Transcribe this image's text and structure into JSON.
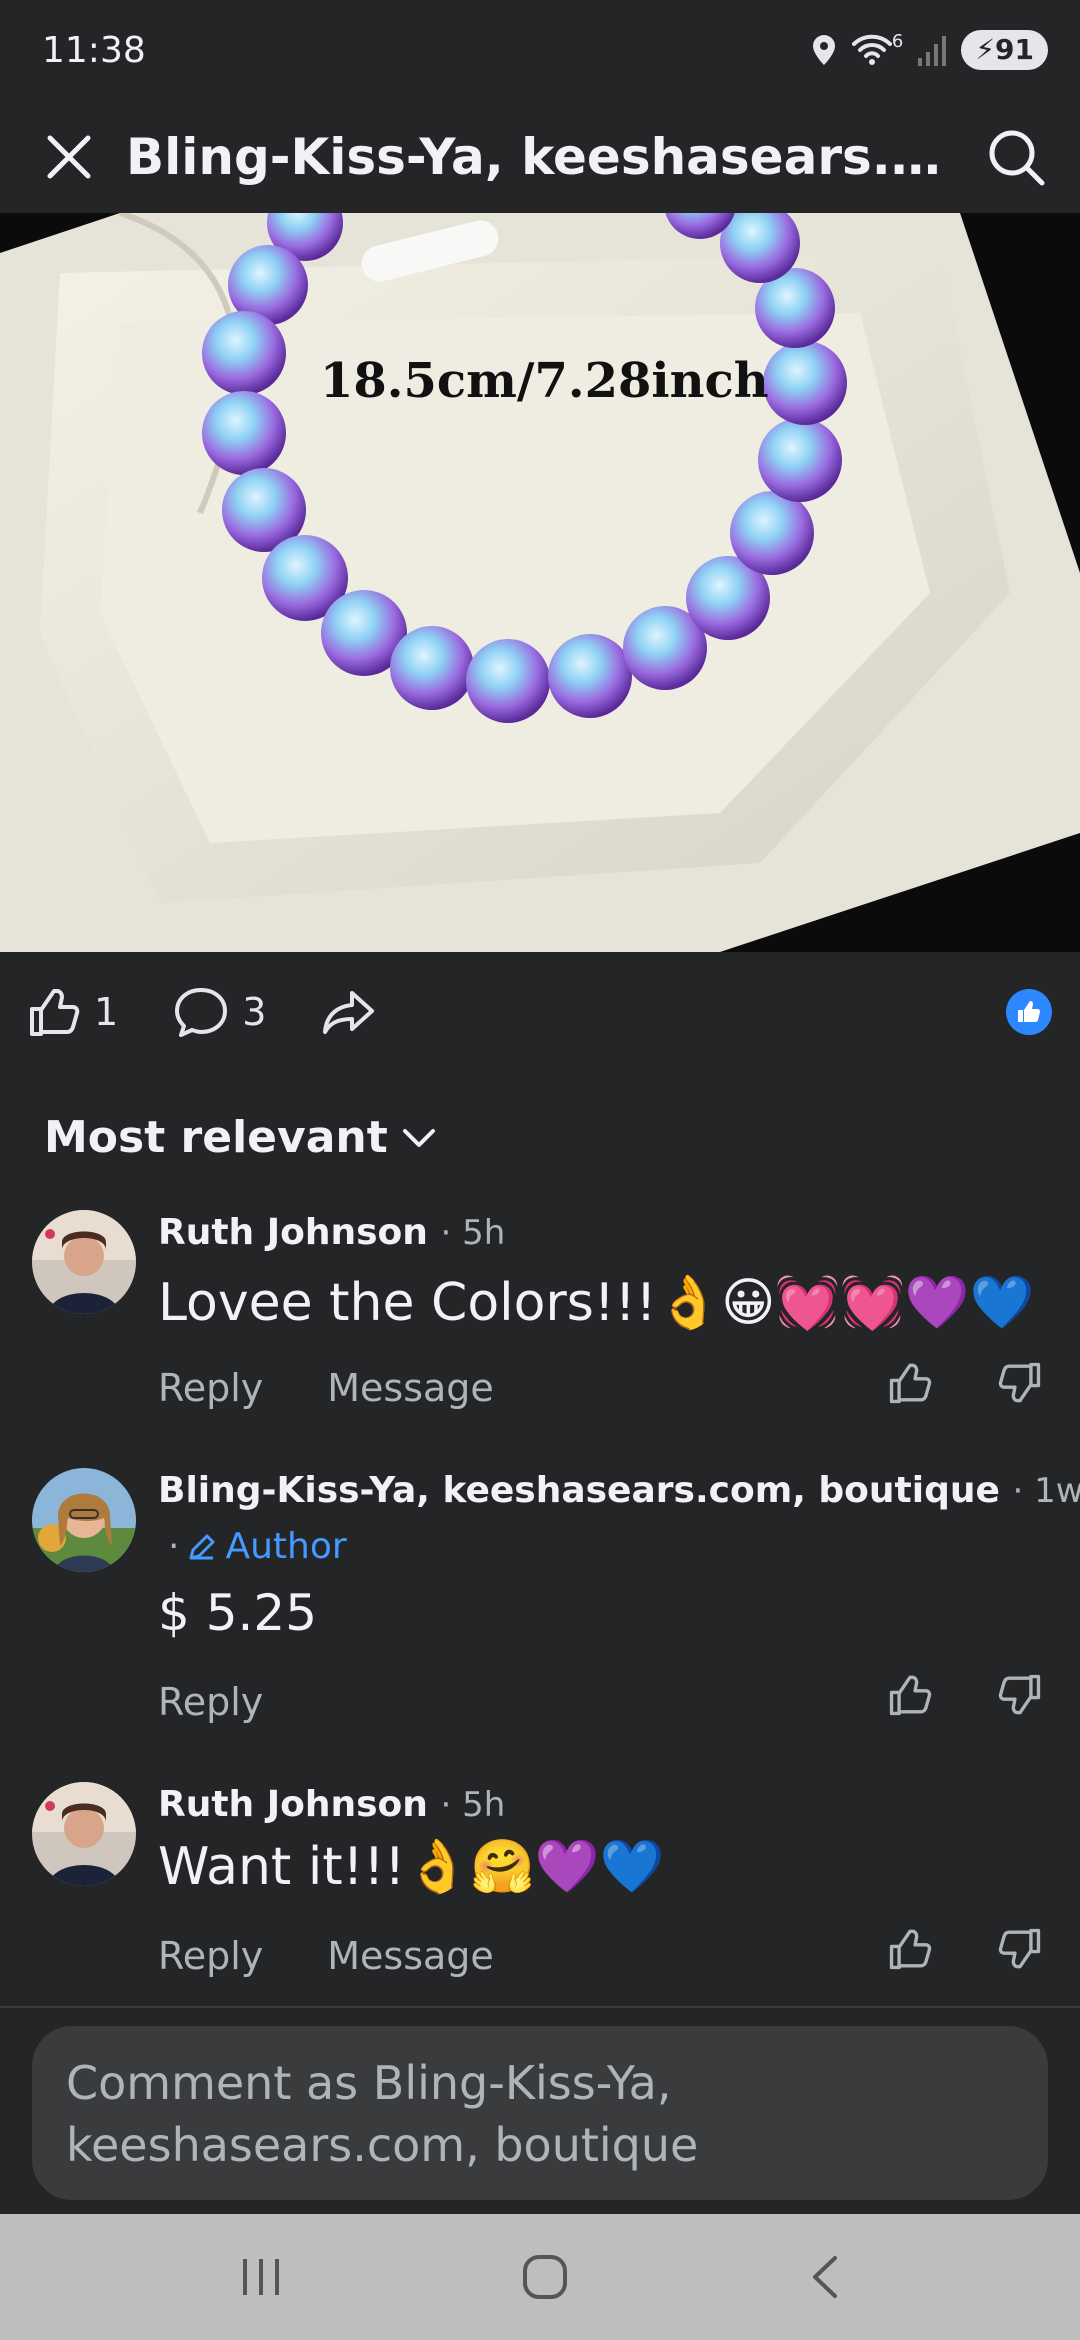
{
  "status_bar": {
    "time": "11:38",
    "battery": "91",
    "network": "6"
  },
  "header": {
    "title": "Bling-Kiss-Ya, keeshasears.com,...",
    "close_icon": "close-icon",
    "search_icon": "search-icon"
  },
  "photo": {
    "size_label": "18.5cm/7.28inch"
  },
  "actions": {
    "like_count": "1",
    "comment_count": "3"
  },
  "sort": {
    "label": "Most relevant"
  },
  "comments": [
    {
      "author": "Ruth Johnson",
      "time": "· 5h",
      "text": "Lovee the Colors!!!👌😀💓💓💜💙",
      "reply": "Reply",
      "message": "Message"
    },
    {
      "author": "Bling-Kiss-Ya, keeshasears.com, boutique",
      "time": "· 1w",
      "badge": "Author",
      "text": "$ 5.25",
      "reply": "Reply"
    },
    {
      "author": "Ruth Johnson",
      "time": "· 5h",
      "text": "Want it!!!👌🤗💜💙",
      "reply": "Reply",
      "message": "Message"
    }
  ],
  "composer": {
    "placeholder": "Comment as Bling-Kiss-Ya, keeshasears.com, boutique"
  },
  "colors": {
    "background": "#242526",
    "accent": "#2d88ff",
    "author_badge": "#4599ff"
  }
}
